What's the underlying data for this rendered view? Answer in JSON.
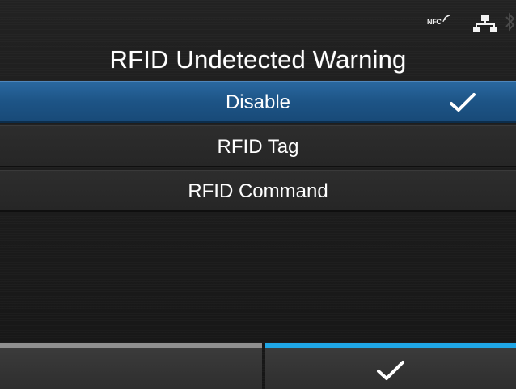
{
  "status_bar": {
    "nfc_label": "NFC",
    "nfc_icon": "nfc-signal-icon",
    "network_icon": "network-icon",
    "bluetooth_icon": "bluetooth-icon"
  },
  "title": "RFID Undetected Warning",
  "options": [
    {
      "label": "Disable",
      "selected": true
    },
    {
      "label": "RFID Tag",
      "selected": false
    },
    {
      "label": "RFID Command",
      "selected": false
    }
  ],
  "selected_icon": "checkmark-icon",
  "soft_keys": {
    "left": {
      "label": ""
    },
    "right": {
      "icon": "checkmark-icon"
    }
  },
  "colors": {
    "selected_row": "#1d5486",
    "accent_blue": "#1fa6e6",
    "inactive_key": "#8f8f8f",
    "background": "#1b1b1b"
  }
}
